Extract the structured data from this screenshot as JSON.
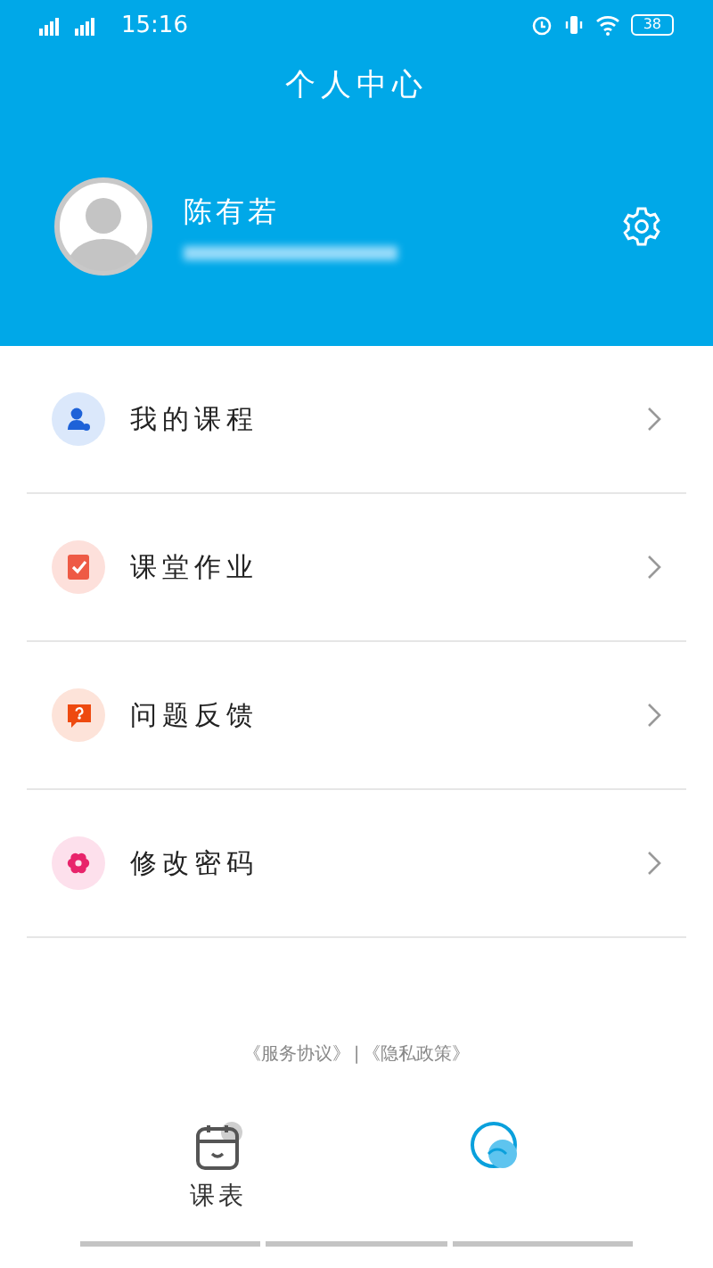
{
  "status_bar": {
    "time": "15:16",
    "battery": "38"
  },
  "header": {
    "title": "个人中心",
    "user_name": "陈有若"
  },
  "menu": [
    {
      "label": "我的课程",
      "kind": "course"
    },
    {
      "label": "课堂作业",
      "kind": "homework"
    },
    {
      "label": "问题反馈",
      "kind": "feedback"
    },
    {
      "label": "修改密码",
      "kind": "password"
    }
  ],
  "footer_links": [
    "《服务协议》",
    "《隐私政策》"
  ],
  "footer_separator": "|",
  "tabs": [
    {
      "label": "课表",
      "kind": "schedule",
      "selected": false
    },
    {
      "kind": "profile",
      "selected": true
    }
  ]
}
